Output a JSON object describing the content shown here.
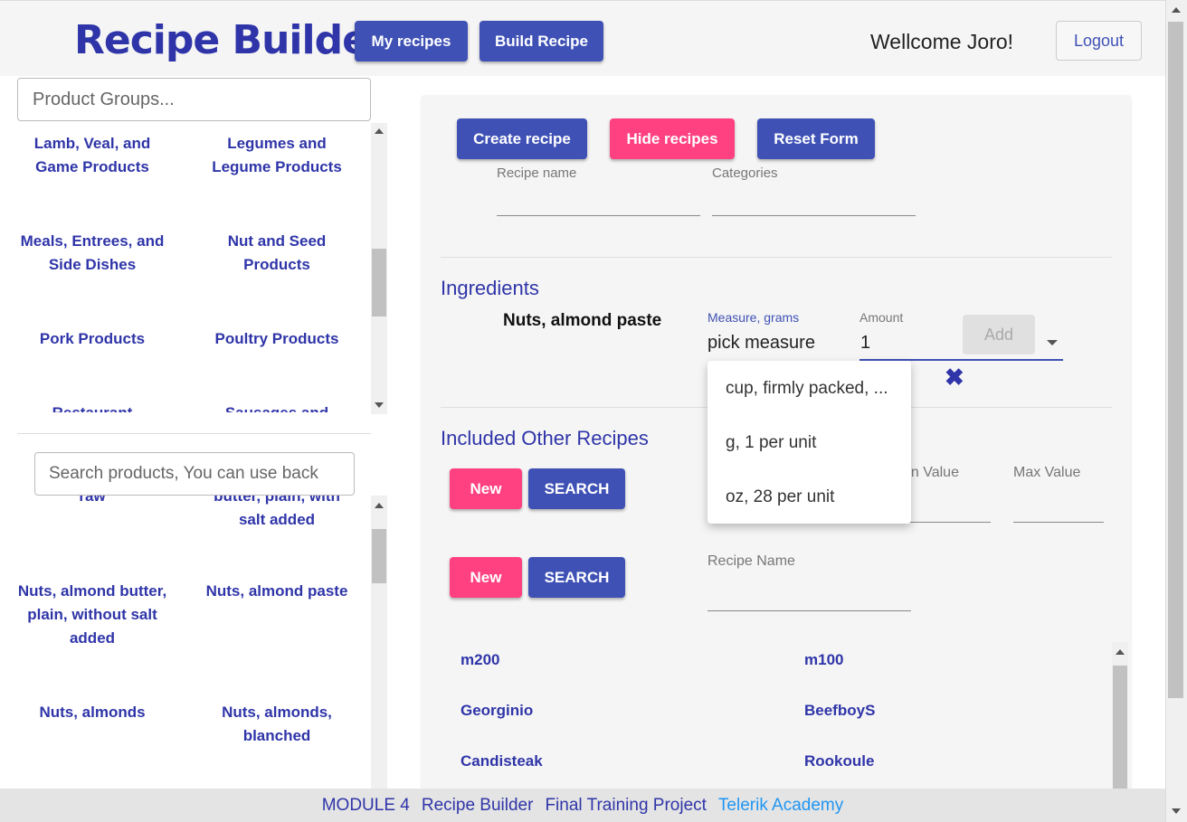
{
  "header": {
    "title": "Recipe Builder",
    "my_recipes": "My recipes",
    "build_recipe": "Build Recipe",
    "welcome": "Wellcome Joro!",
    "logout": "Logout"
  },
  "left": {
    "product_groups_placeholder": "Product Groups...",
    "groups": [
      "Lamb, Veal, and Game Products",
      "Legumes and Legume Products",
      "Meals, Entrees, and Side Dishes",
      "Nut and Seed Products",
      "Pork Products",
      "Poultry Products",
      "Restaurant",
      "Sausages and"
    ],
    "search_placeholder": "Search products, You can use back",
    "products": [
      "raw",
      "butter, plain, with salt added",
      "Nuts, almond butter, plain, without salt added",
      "Nuts, almond paste",
      "Nuts, almonds",
      "Nuts, almonds, blanched"
    ]
  },
  "form": {
    "create_recipe": "Create recipe",
    "hide_recipes": "Hide recipes",
    "reset_form": "Reset Form",
    "recipe_name_label": "Recipe name",
    "categories_label": "Categories"
  },
  "ingredients": {
    "title": "Ingredients",
    "item_name": "Nuts, almond paste",
    "measure_label": "Measure, grams",
    "measure_value": "pick measure",
    "amount_label": "Amount",
    "amount_value": "1",
    "add_label": "Add",
    "measure_options": [
      "cup, firmly packed, ...",
      "g, 1 per unit",
      "oz, 28 per unit"
    ]
  },
  "included": {
    "title": "Included Other Recipes",
    "new_label": "New",
    "search_label": "SEARCH",
    "min_value_label": "Min Value",
    "max_value_label": "Max Value",
    "recipe_name_label": "Recipe Name",
    "recipes": [
      "m200",
      "m100",
      "Georginio",
      "BeefboyS",
      "Candisteak",
      "Rookoule"
    ]
  },
  "footer": {
    "module": "MODULE 4",
    "app": "Recipe Builder",
    "project": "Final Training Project",
    "academy": "Telerik Academy"
  },
  "colors": {
    "primary": "#3f51b5",
    "accent": "#ff4081",
    "brand_text": "#2f35a8",
    "link": "#2196f3"
  }
}
